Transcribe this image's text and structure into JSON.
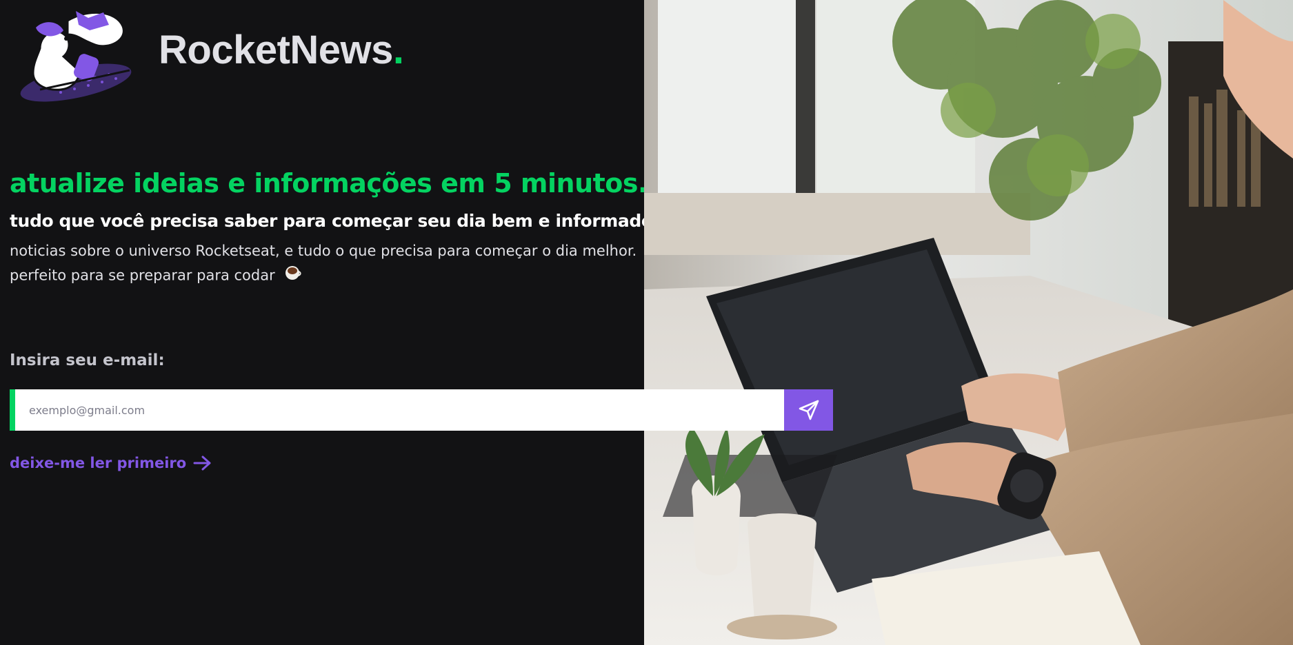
{
  "brand": {
    "name": "RocketNews",
    "dot": "."
  },
  "hero": {
    "headline": "atualize ideias e informações em 5 minutos.",
    "subheadline": "tudo que você precisa saber para começar seu dia bem e informado",
    "description_line1": "noticias sobre o universo Rocketseat, e tudo o que precisa para começar o dia melhor.",
    "description_line2": "perfeito para se preparar para codar",
    "coffee_icon": "coffee-cup-icon"
  },
  "form": {
    "label": "Insira seu e-mail:",
    "email_placeholder": "exemplo@gmail.com",
    "email_value": "",
    "send_icon": "send-paper-plane-icon"
  },
  "link": {
    "label": "deixe-me ler primeiro",
    "icon": "arrow-right-icon"
  },
  "colors": {
    "background": "#121214",
    "accent_green": "#04d361",
    "accent_purple": "#8257e5",
    "text_light": "#e1e1e6"
  }
}
